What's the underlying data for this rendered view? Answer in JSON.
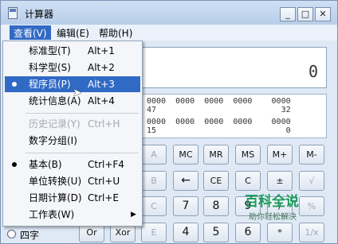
{
  "window": {
    "title": "计算器"
  },
  "title_buttons": {
    "minimize": "_",
    "maximize": "□",
    "close": "✕"
  },
  "menubar": [
    "查看(V)",
    "编辑(E)",
    "帮助(H)"
  ],
  "display": {
    "value": "0"
  },
  "binary": {
    "row1": "0000  0000  0000  0000    0000",
    "row1b": "47                          32",
    "row2": "0000  0000  0000  0000    0000",
    "row2b": "15                           0"
  },
  "view_menu": {
    "items": [
      {
        "label": "标准型(T)",
        "shortcut": "Alt+1"
      },
      {
        "label": "科学型(S)",
        "shortcut": "Alt+2"
      },
      {
        "label": "程序员(P)",
        "shortcut": "Alt+3"
      },
      {
        "label": "统计信息(A)",
        "shortcut": "Alt+4"
      },
      {
        "label": "历史记录(Y)",
        "shortcut": "Ctrl+H"
      },
      {
        "label": "数字分组(I)",
        "shortcut": ""
      },
      {
        "label": "基本(B)",
        "shortcut": "Ctrl+F4"
      },
      {
        "label": "单位转换(U)",
        "shortcut": "Ctrl+U"
      },
      {
        "label": "日期计算(D)",
        "shortcut": "Ctrl+E"
      },
      {
        "label": "工作表(W)",
        "shortcut": ""
      }
    ],
    "submenu_arrow": "▶"
  },
  "keys": {
    "r1": [
      "A",
      "MC",
      "MR",
      "MS",
      "M+",
      "M-"
    ],
    "r2": [
      "B",
      "←",
      "CE",
      "C",
      "±",
      "√"
    ],
    "r3": [
      "C",
      "7",
      "8",
      "9",
      "/",
      "%"
    ],
    "r4": [
      "Or",
      "Xor",
      "E",
      "4",
      "5",
      "6",
      "*",
      "1/x"
    ]
  },
  "radio_peek": "四字",
  "watermark": {
    "title": "百科全说",
    "subtitle": "助你轻松解决"
  }
}
